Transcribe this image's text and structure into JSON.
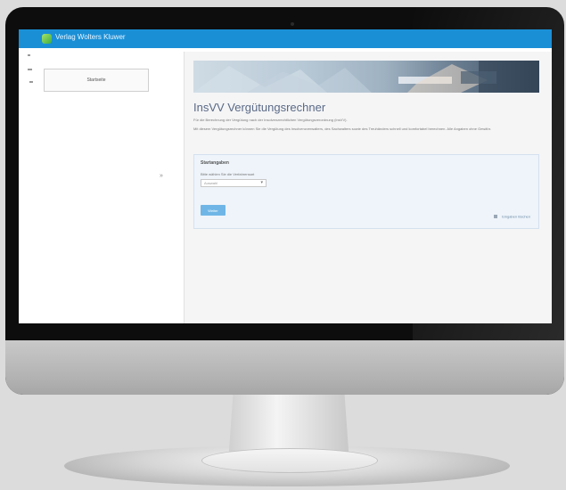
{
  "header": {
    "brand_name": "Verlag Wolters Kluwer",
    "logo_icon": "brand-logo-icon"
  },
  "sidebar": {
    "nav_item_label": "Startseite"
  },
  "main": {
    "title": "InsVV Vergütungsrechner",
    "intro_line": "Für die Berechnung der Vergütung nach der Insolvenzrechtlichen Vergütungsverordnung (InsVV).",
    "intro_paragraph": "Mit diesem Vergütungsrechner können Sie die Vergütung des Insolvenzverwalters, des Sachwalters sowie des Treuhänders schnell und komfortabel berechnen. Alle Angaben ohne Gewähr.",
    "card": {
      "title": "Startangaben",
      "field_label": "Bitte wählen Sie die Verfahrensart",
      "select_value": "Auswahl",
      "primary_button": "Weiter",
      "secondary_action": "Eingaben löschen",
      "secondary_icon": "reset-icon"
    }
  },
  "colors": {
    "app_bar": "#1a8fd6",
    "title": "#5a6a86",
    "card_bg": "#eef4fa",
    "button": "#6fb6e6"
  }
}
